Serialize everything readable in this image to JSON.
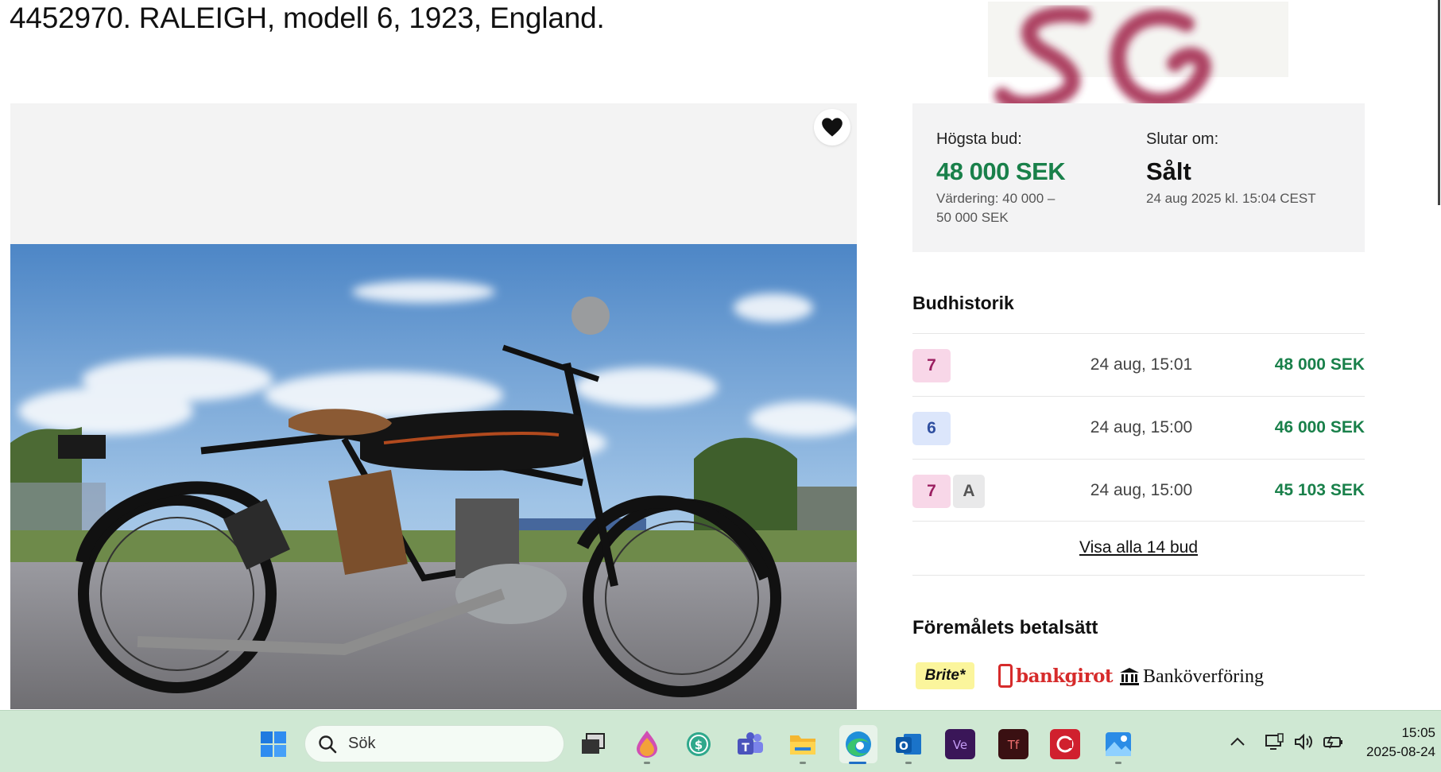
{
  "page": {
    "title": "4452970. RALEIGH, modell 6, 1923, England."
  },
  "watermark": {
    "text": "SG"
  },
  "gallery": {
    "favorite_icon": "heart-icon",
    "photo_alt": "Raleigh motorcycle"
  },
  "bid_panel": {
    "highest_bid_label": "Högsta bud:",
    "highest_bid_value": "48 000 SEK",
    "valuation_line1": "Värdering: 40 000 –",
    "valuation_line2": "50 000 SEK",
    "ends_label": "Slutar om:",
    "ends_value": "Sålt",
    "ends_date": "24 aug 2025 kl. 15:04 CEST"
  },
  "bid_history": {
    "title": "Budhistorik",
    "rows": [
      {
        "bidder": "7",
        "extra": "",
        "time": "24 aug, 15:01",
        "amount": "48 000 SEK"
      },
      {
        "bidder": "6",
        "extra": "",
        "time": "24 aug, 15:00",
        "amount": "46 000 SEK"
      },
      {
        "bidder": "7",
        "extra": "A",
        "time": "24 aug, 15:00",
        "amount": "45 103 SEK"
      }
    ],
    "show_all": "Visa alla 14 bud"
  },
  "payment": {
    "title": "Föremålets betalsätt",
    "methods": [
      "Brite*",
      "bankgirot",
      "Banköverföring"
    ]
  },
  "colors": {
    "price_green": "#19804a",
    "badge_pink": "#f8d7e8",
    "badge_blue": "#dce6fb",
    "taskbar_bg": "#cfe8d3"
  },
  "taskbar": {
    "search_placeholder": "Sök",
    "icons": [
      "windows-start-icon",
      "search-icon",
      "task-view-icon",
      "paint-icon",
      "money-app-icon",
      "teams-icon",
      "file-explorer-icon",
      "edge-icon",
      "outlook-icon",
      "ve-app-icon",
      "tf-app-icon",
      "red-app-icon",
      "photos-icon"
    ],
    "tray_icons": [
      "chevron-up-icon",
      "network-icon",
      "volume-icon",
      "battery-icon"
    ],
    "time": "15:05",
    "date": "2025-08-24"
  }
}
